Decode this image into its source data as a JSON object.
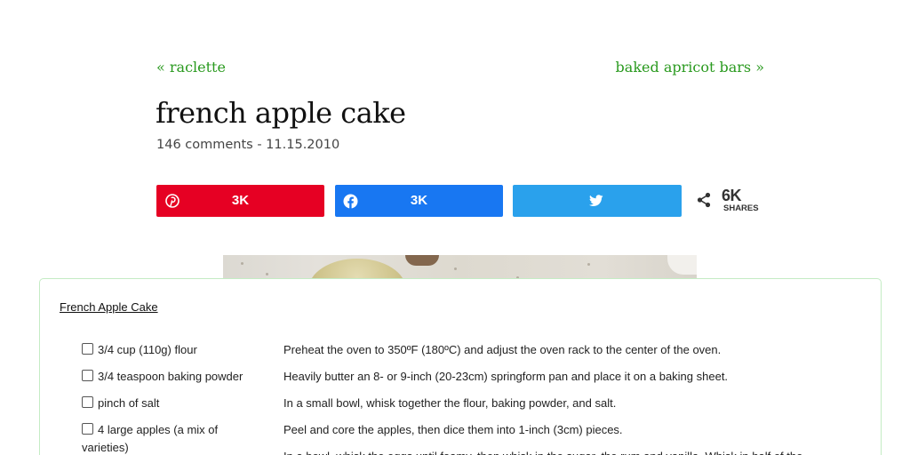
{
  "nav": {
    "prev_label": "« raclette",
    "next_label": "baked apricot bars »"
  },
  "post": {
    "title": "french apple cake",
    "meta": "146 comments - 11.15.2010"
  },
  "share": {
    "pinterest_count": "3K",
    "facebook_count": "3K",
    "twitter_count": "",
    "total_count": "6K",
    "total_label": "SHARES",
    "colors": {
      "pinterest": "#e60023",
      "facebook": "#1877f2",
      "twitter": "#2aa1ec"
    },
    "icons": [
      "pinterest-icon",
      "facebook-icon",
      "twitter-icon",
      "share-icon"
    ]
  },
  "recipe": {
    "title": "French Apple Cake",
    "ingredients": [
      "3/4 cup (110g) flour",
      "3/4 teaspoon baking powder",
      "pinch of salt",
      "4 large apples (a mix of varieties)"
    ],
    "directions": [
      "Preheat the oven to 350ºF (180ºC) and adjust the oven rack to the center of the oven.",
      "Heavily butter an 8- or 9-inch (20-23cm) springform pan and place it on a baking sheet.",
      "In a small bowl, whisk together the flour, baking powder, and salt.",
      "Peel and core the apples, then dice them into 1-inch (3cm) pieces.",
      "In a bowl, whisk the eggs until foamy, then whisk in the sugar, the rum and vanilla. Whisk in half of the"
    ]
  },
  "colors": {
    "link": "#2a9a1f",
    "card_border": "#c4ecc4"
  }
}
